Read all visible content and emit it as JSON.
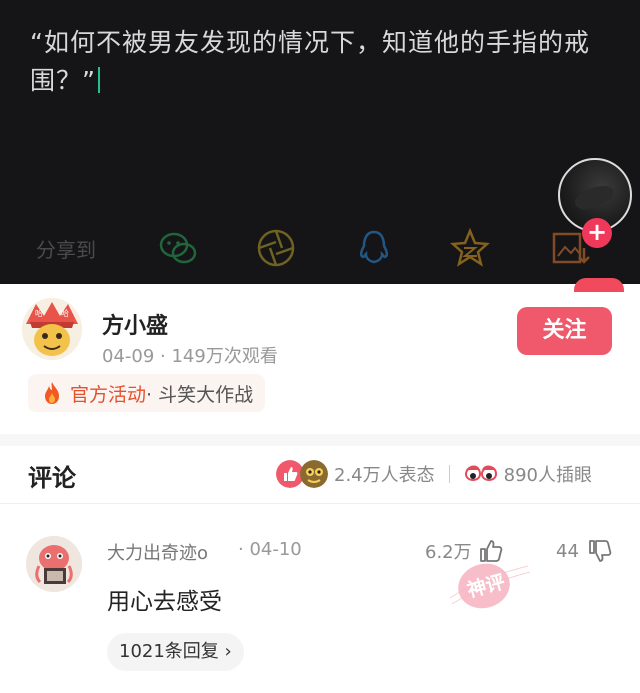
{
  "video": {
    "caption": "“如何不被男友发现的情况下，知道他的手指的戒围？”",
    "share_label": "分享到",
    "share_targets": [
      "wechat-icon",
      "moments-icon",
      "qq-icon",
      "qzone-icon",
      "save-image-icon"
    ],
    "plus_glyph": "+"
  },
  "author": {
    "name": "方小盛",
    "meta": "04-09 · 149万次观看",
    "follow_label": "关注",
    "activity_highlight": "官方活动",
    "activity_rest": " · 斗笑大作战"
  },
  "comments_header": {
    "title": "评论",
    "reactions_text": "2.4万人表态",
    "inserts_text": "890人插眼"
  },
  "comment": {
    "user": "大力出奇迹o",
    "date": "· 04-10",
    "likes": "6.2万",
    "dislikes": "44",
    "text": "用心去感受",
    "replies_label": "1021条回复 ›",
    "stamp_text": "神评"
  },
  "colors": {
    "accent": "#f0596b",
    "activity": "#e5512d",
    "video_bg": "#151417"
  }
}
